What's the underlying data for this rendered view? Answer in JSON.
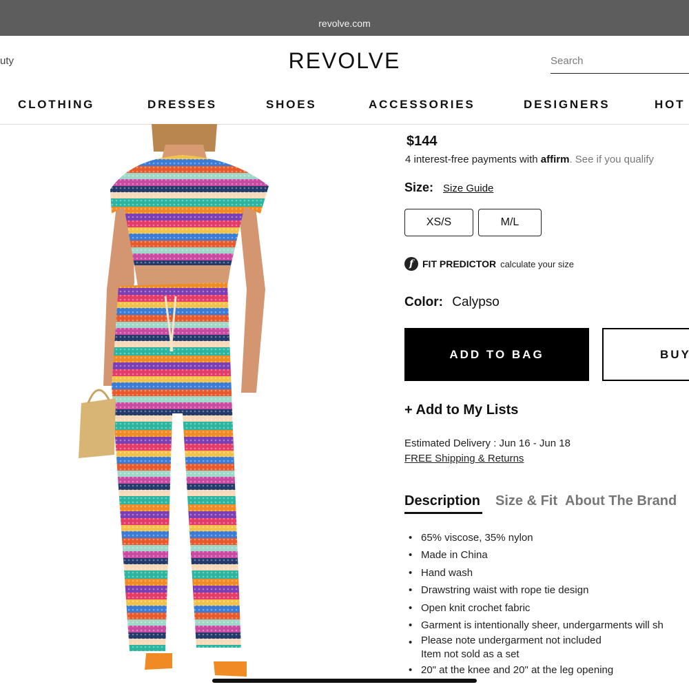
{
  "browser": {
    "url": "revolve.com"
  },
  "header": {
    "left_nav_fragment": "uty",
    "logo": "REVOLVE",
    "search_placeholder": "Search"
  },
  "nav": {
    "items": [
      "CLOTHING",
      "DRESSES",
      "SHOES",
      "ACCESSORIES",
      "DESIGNERS",
      "HOT"
    ]
  },
  "product": {
    "price": "$144",
    "affirm": {
      "prefix": "4 interest-free payments with",
      "brand": "affirm",
      "qualify": ". See if you qualify"
    },
    "size": {
      "label": "Size:",
      "guide_link": "Size Guide",
      "options": [
        "XS/S",
        "M/L"
      ]
    },
    "fit_predictor": {
      "title": "FIT PREDICTOR",
      "subtitle": "calculate your size"
    },
    "color": {
      "label": "Color:",
      "value": "Calypso"
    },
    "add_to_bag": "ADD TO BAG",
    "buy_now": "BUY",
    "add_to_lists": "+ Add to My Lists",
    "delivery": "Estimated Delivery : Jun 16 - Jun 18",
    "shipping": "FREE Shipping & Returns",
    "tabs": [
      "Description",
      "Size & Fit",
      "About The Brand"
    ],
    "description": [
      "65% viscose, 35% nylon",
      "Made in China",
      "Hand wash",
      "Drawstring waist with rope tie design",
      "Open knit crochet fabric",
      "Garment is intentionally sheer, undergarments will sh",
      "Please note undergarment not included",
      "Item not sold as a set",
      "20\" at the knee and 20\" at the leg opening"
    ]
  },
  "colors": {
    "url_bar": "#5d5d5d",
    "primary_button": "#000000",
    "text": "#111111",
    "muted": "#777777"
  }
}
